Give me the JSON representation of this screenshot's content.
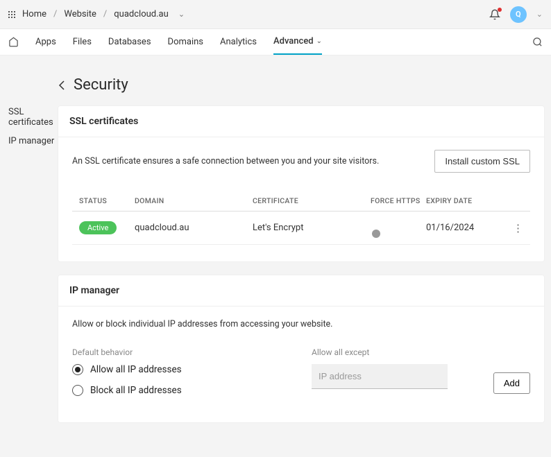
{
  "topbar": {
    "breadcrumb": [
      "Home",
      "Website",
      "quadcloud.au"
    ],
    "avatar_letter": "Q"
  },
  "nav": {
    "items": [
      "Apps",
      "Files",
      "Databases",
      "Domains",
      "Analytics",
      "Advanced"
    ]
  },
  "sidebar": {
    "items": [
      "SSL certificates",
      "IP manager"
    ]
  },
  "page": {
    "title": "Security"
  },
  "ssl_card": {
    "header": "SSL certificates",
    "intro": "An SSL certificate ensures a safe connection between you and your site visitors.",
    "install_btn": "Install custom SSL",
    "columns": [
      "STATUS",
      "DOMAIN",
      "CERTIFICATE",
      "FORCE HTTPS",
      "EXPIRY DATE"
    ],
    "row": {
      "status": "Active",
      "domain": "quadcloud.au",
      "certificate": "Let's Encrypt",
      "expiry": "01/16/2024"
    }
  },
  "ip_card": {
    "header": "IP manager",
    "intro": "Allow or block individual IP addresses from accessing your website.",
    "default_label": "Default behavior",
    "radio_allow": "Allow all IP addresses",
    "radio_block": "Block all IP addresses",
    "except_label": "Allow all except",
    "ip_placeholder": "IP address",
    "add_btn": "Add"
  }
}
